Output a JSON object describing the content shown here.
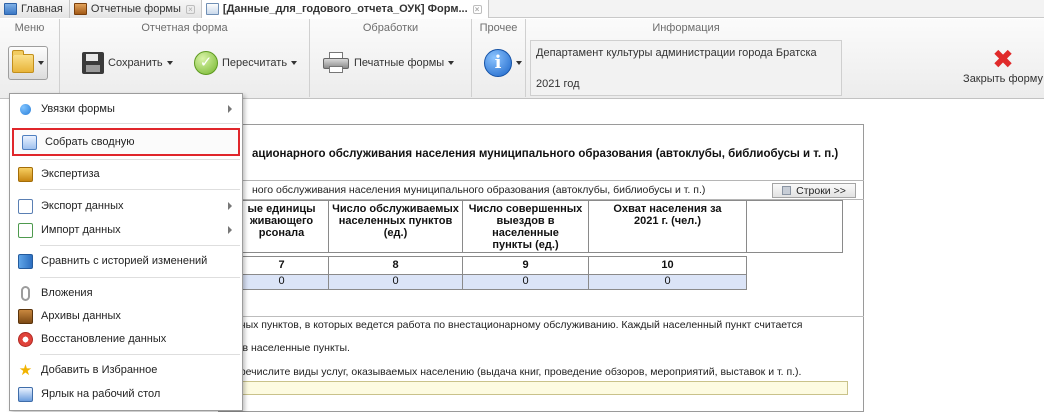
{
  "tabs": [
    {
      "label": "Главная",
      "icon": "home-icon",
      "closable": false
    },
    {
      "label": "Отчетные формы",
      "icon": "book-icon",
      "closable": true
    },
    {
      "label": "[Данные_для_годового_отчета_ОУК] Форм...",
      "icon": "data-icon",
      "closable": true
    }
  ],
  "ribbon": {
    "groups": {
      "menu": "Меню",
      "report_form": "Отчетная форма",
      "processing": "Обработки",
      "other": "Прочее",
      "info": "Информация"
    },
    "save_label": "Сохранить",
    "recalc_label": "Пересчитать",
    "print_label": "Печатные формы",
    "info_line1": "Департамент культуры администрации города Братска",
    "info_line2": "2021 год",
    "close_form_label": "Закрыть форму"
  },
  "form": {
    "title": "ационарного обслуживания населения муниципального образования (автоклубы, библиобусы и т. п.)",
    "subheader": "ного обслуживания населения муниципального образования (автоклубы, библиобусы и т. п.)",
    "rows_button": "Строки >>",
    "columns": [
      {
        "header_lines": [
          "ые единицы",
          "живающего",
          "рсонала"
        ],
        "num": "7",
        "value": "0"
      },
      {
        "header_lines": [
          "Число обслуживаемых",
          "населенных пунктов",
          "(ед.)"
        ],
        "num": "8",
        "value": "0"
      },
      {
        "header_lines": [
          "Число совершенных",
          "выездов в населенные",
          "пункты (ед.)"
        ],
        "num": "9",
        "value": "0"
      },
      {
        "header_lines": [
          "Охват населения за",
          "2021 г. (чел.)"
        ],
        "num": "10",
        "value": "0"
      }
    ],
    "note1": "нных пунктов, в которых ведется работа по внестационарному обслуживанию. Каждый населенный пункт считается",
    "note2": "в в населенные пункты.",
    "note3": "еречислите виды услуг, оказываемых населению (выдача книг, проведение обзоров, мероприятий, выставок и т. п.)."
  },
  "menu": {
    "items": [
      {
        "label": "Увязки формы",
        "icon": "links-icon",
        "submenu": true
      },
      {
        "label": "Собрать сводную",
        "icon": "collect-icon",
        "submenu": false,
        "highlighted": true
      },
      {
        "label": "Экспертиза",
        "icon": "expertise-icon",
        "submenu": false
      },
      {
        "label": "Экспорт данных",
        "icon": "export-icon",
        "submenu": true
      },
      {
        "label": "Импорт данных",
        "icon": "import-icon",
        "submenu": true
      },
      {
        "label": "Сравнить с историей изменений",
        "icon": "compare-icon",
        "submenu": false
      },
      {
        "label": "Вложения",
        "icon": "attachment-icon",
        "submenu": false
      },
      {
        "label": "Архивы данных",
        "icon": "archive-icon",
        "submenu": false
      },
      {
        "label": "Восстановление данных",
        "icon": "restore-icon",
        "submenu": false
      },
      {
        "label": "Добавить в Избранное",
        "icon": "star-icon",
        "submenu": false
      },
      {
        "label": "Ярлык на рабочий стол",
        "icon": "shortcut-icon",
        "submenu": false
      }
    ]
  },
  "colors": {
    "highlight_border": "#e0262b",
    "value_cell_bg": "#dbe4f7",
    "close_icon": "#e02a2a"
  }
}
